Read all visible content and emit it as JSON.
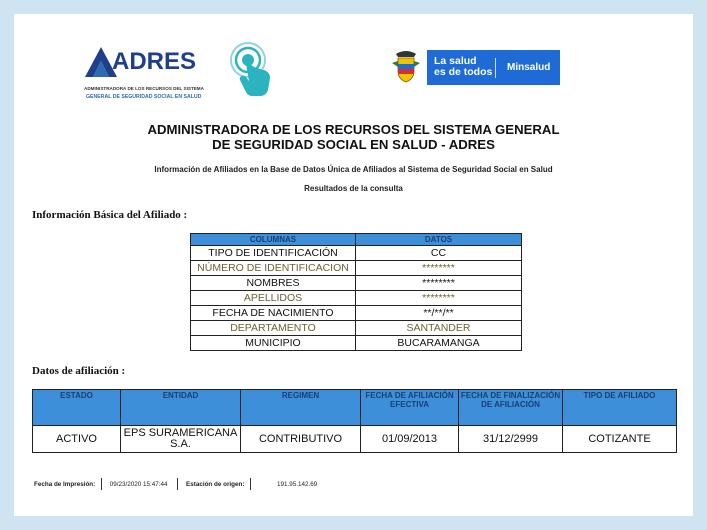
{
  "header": {
    "adres": {
      "wordmark": "ADRES",
      "line1": "ADMINISTRADORA DE LOS RECURSOS DEL SISTEMA",
      "line2": "GENERAL DE SEGURIDAD SOCIAL EN SALUD"
    },
    "minsalud": {
      "slogan_line1": "La salud",
      "slogan_line2": "es de todos",
      "ministry": "Minsalud"
    },
    "icons": [
      "adres-logo-icon",
      "touch-icon",
      "colombia-shield-icon"
    ],
    "colors": {
      "brand_blue": "#1f3f8a",
      "minsalud_blue": "#1e6bd6",
      "touch_cyan": "#2bb3c0",
      "table_header": "#3d8fd9"
    }
  },
  "title": {
    "line1": "ADMINISTRADORA DE LOS RECURSOS DEL SISTEMA GENERAL",
    "line2": "DE SEGURIDAD SOCIAL EN SALUD - ADRES"
  },
  "subtitle": "Información de Afiliados en la Base de Datos Única de Afiliados al Sistema de Seguridad Social en Salud",
  "results_label": "Resultados de la consulta",
  "basic_info": {
    "heading": "Información Básica del Afiliado :",
    "columns": [
      "COLUMNAS",
      "DATOS"
    ],
    "rows": [
      {
        "label": "TIPO DE IDENTIFICACIÓN",
        "value": "CC"
      },
      {
        "label": "NÚMERO DE IDENTIFICACION",
        "value": "********"
      },
      {
        "label": "NOMBRES",
        "value": "********"
      },
      {
        "label": "APELLIDOS",
        "value": "********"
      },
      {
        "label": "FECHA DE NACIMIENTO",
        "value": "**/**/**"
      },
      {
        "label": "DEPARTAMENTO",
        "value": "SANTANDER"
      },
      {
        "label": "MUNICIPIO",
        "value": "BUCARAMANGA"
      }
    ]
  },
  "affiliation": {
    "heading": "Datos de afiliación :",
    "columns": [
      "ESTADO",
      "ENTIDAD",
      "REGIMEN",
      "FECHA DE AFILIACIÓN EFECTIVA",
      "FECHA DE FINALIZACIÓN DE AFILIACIÓN",
      "TIPO DE AFILIADO"
    ],
    "row": [
      "ACTIVO",
      "EPS SURAMERICANA S.A.",
      "CONTRIBUTIVO",
      "01/09/2013",
      "31/12/2999",
      "COTIZANTE"
    ]
  },
  "footer": {
    "print_date_label": "Fecha de Impresión:",
    "print_date": "09/23/2020 15:47:44",
    "origin_label": "Estación de origen:",
    "origin_ip": "191.95.142.69"
  }
}
